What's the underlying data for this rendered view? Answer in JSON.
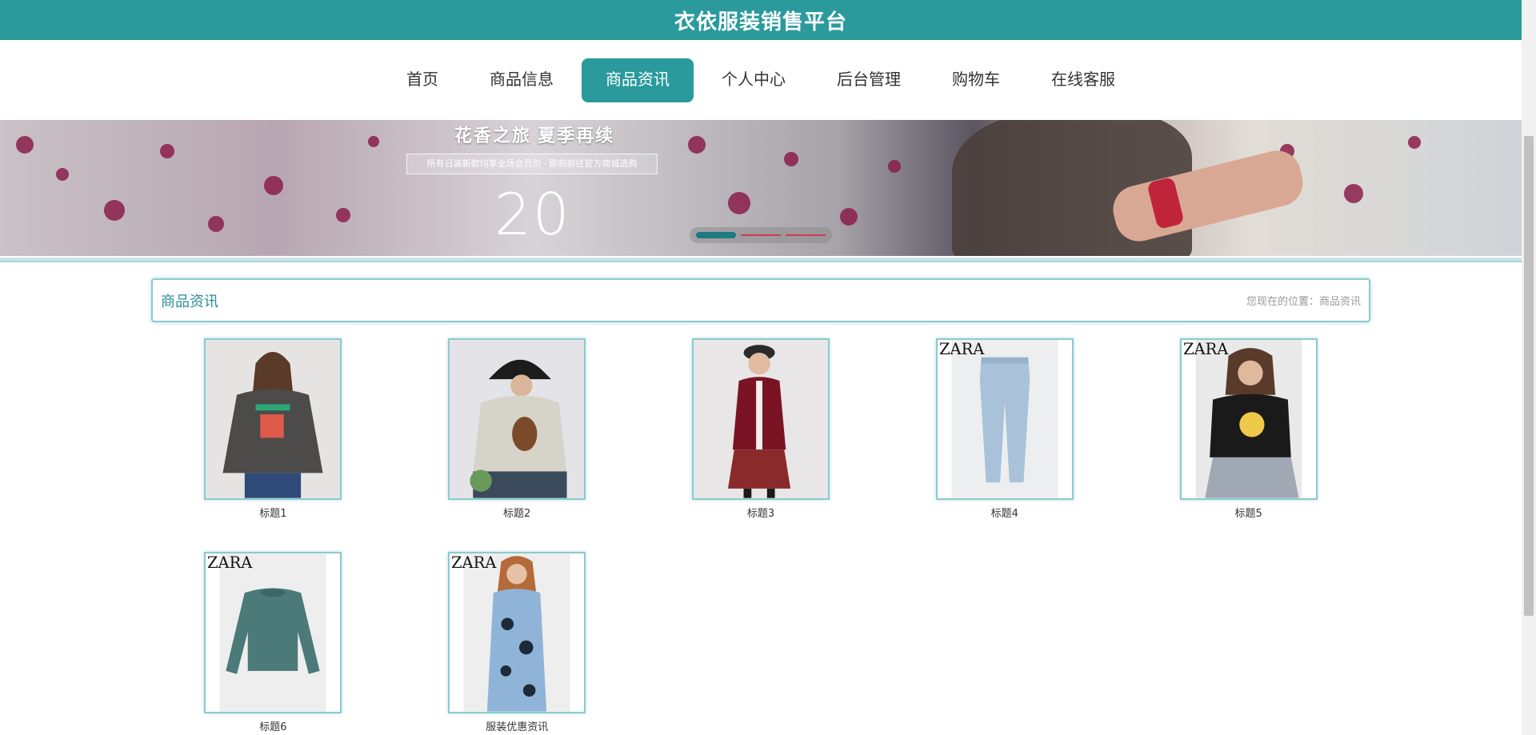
{
  "header": {
    "site_title": "衣依服装销售平台"
  },
  "nav": {
    "items": [
      {
        "label": "首页"
      },
      {
        "label": "商品信息"
      },
      {
        "label": "商品资讯",
        "active": true
      },
      {
        "label": "个人中心"
      },
      {
        "label": "后台管理"
      },
      {
        "label": "购物车"
      },
      {
        "label": "在线客服"
      }
    ]
  },
  "banner": {
    "heading": "花香之旅 夏季再续",
    "subline": "所有日装新款均享全场会员价 · 即刻前往官方商城选购",
    "number": "20",
    "slides_count": 3,
    "active_slide": 1
  },
  "section": {
    "title": "商品资讯",
    "breadcrumb": "您现在的位置：商品资讯"
  },
  "products": [
    {
      "title": "标题1",
      "image": "woman-grey-sweatshirt"
    },
    {
      "title": "标题2",
      "image": "woman-bucket-hat-sweater"
    },
    {
      "title": "标题3",
      "image": "woman-red-cardigan"
    },
    {
      "title": "标题4",
      "image": "zara-light-jeans"
    },
    {
      "title": "标题5",
      "image": "zara-woman-black-tee"
    },
    {
      "title": "标题6",
      "image": "zara-green-sweatshirt"
    },
    {
      "title": "服装优惠资讯",
      "image": "zara-woman-floral-dress"
    }
  ],
  "colors": {
    "accent": "#2a9a9c",
    "border": "#8ccad0"
  }
}
